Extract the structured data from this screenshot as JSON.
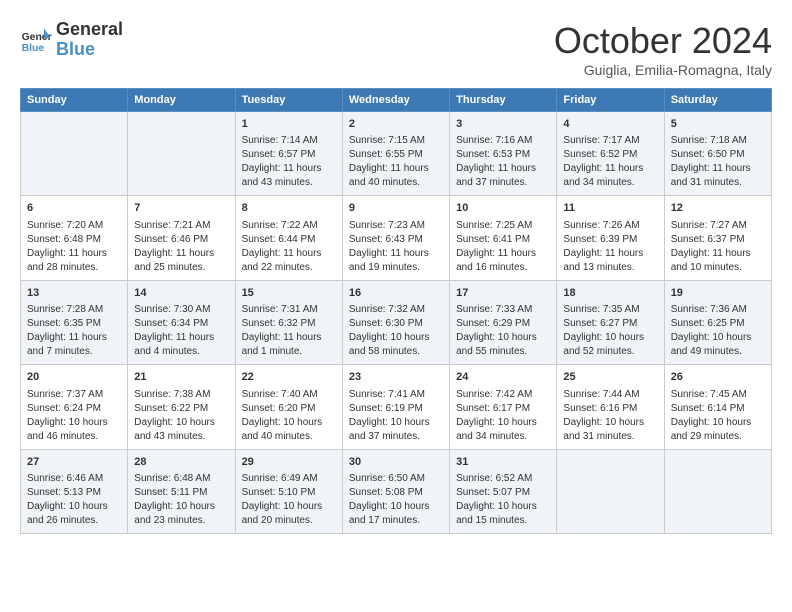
{
  "header": {
    "logo_line1": "General",
    "logo_line2": "Blue",
    "month": "October 2024",
    "location": "Guiglia, Emilia-Romagna, Italy"
  },
  "weekdays": [
    "Sunday",
    "Monday",
    "Tuesday",
    "Wednesday",
    "Thursday",
    "Friday",
    "Saturday"
  ],
  "weeks": [
    [
      {
        "day": "",
        "info": ""
      },
      {
        "day": "",
        "info": ""
      },
      {
        "day": "1",
        "info": "Sunrise: 7:14 AM\nSunset: 6:57 PM\nDaylight: 11 hours\nand 43 minutes."
      },
      {
        "day": "2",
        "info": "Sunrise: 7:15 AM\nSunset: 6:55 PM\nDaylight: 11 hours\nand 40 minutes."
      },
      {
        "day": "3",
        "info": "Sunrise: 7:16 AM\nSunset: 6:53 PM\nDaylight: 11 hours\nand 37 minutes."
      },
      {
        "day": "4",
        "info": "Sunrise: 7:17 AM\nSunset: 6:52 PM\nDaylight: 11 hours\nand 34 minutes."
      },
      {
        "day": "5",
        "info": "Sunrise: 7:18 AM\nSunset: 6:50 PM\nDaylight: 11 hours\nand 31 minutes."
      }
    ],
    [
      {
        "day": "6",
        "info": "Sunrise: 7:20 AM\nSunset: 6:48 PM\nDaylight: 11 hours\nand 28 minutes."
      },
      {
        "day": "7",
        "info": "Sunrise: 7:21 AM\nSunset: 6:46 PM\nDaylight: 11 hours\nand 25 minutes."
      },
      {
        "day": "8",
        "info": "Sunrise: 7:22 AM\nSunset: 6:44 PM\nDaylight: 11 hours\nand 22 minutes."
      },
      {
        "day": "9",
        "info": "Sunrise: 7:23 AM\nSunset: 6:43 PM\nDaylight: 11 hours\nand 19 minutes."
      },
      {
        "day": "10",
        "info": "Sunrise: 7:25 AM\nSunset: 6:41 PM\nDaylight: 11 hours\nand 16 minutes."
      },
      {
        "day": "11",
        "info": "Sunrise: 7:26 AM\nSunset: 6:39 PM\nDaylight: 11 hours\nand 13 minutes."
      },
      {
        "day": "12",
        "info": "Sunrise: 7:27 AM\nSunset: 6:37 PM\nDaylight: 11 hours\nand 10 minutes."
      }
    ],
    [
      {
        "day": "13",
        "info": "Sunrise: 7:28 AM\nSunset: 6:35 PM\nDaylight: 11 hours\nand 7 minutes."
      },
      {
        "day": "14",
        "info": "Sunrise: 7:30 AM\nSunset: 6:34 PM\nDaylight: 11 hours\nand 4 minutes."
      },
      {
        "day": "15",
        "info": "Sunrise: 7:31 AM\nSunset: 6:32 PM\nDaylight: 11 hours\nand 1 minute."
      },
      {
        "day": "16",
        "info": "Sunrise: 7:32 AM\nSunset: 6:30 PM\nDaylight: 10 hours\nand 58 minutes."
      },
      {
        "day": "17",
        "info": "Sunrise: 7:33 AM\nSunset: 6:29 PM\nDaylight: 10 hours\nand 55 minutes."
      },
      {
        "day": "18",
        "info": "Sunrise: 7:35 AM\nSunset: 6:27 PM\nDaylight: 10 hours\nand 52 minutes."
      },
      {
        "day": "19",
        "info": "Sunrise: 7:36 AM\nSunset: 6:25 PM\nDaylight: 10 hours\nand 49 minutes."
      }
    ],
    [
      {
        "day": "20",
        "info": "Sunrise: 7:37 AM\nSunset: 6:24 PM\nDaylight: 10 hours\nand 46 minutes."
      },
      {
        "day": "21",
        "info": "Sunrise: 7:38 AM\nSunset: 6:22 PM\nDaylight: 10 hours\nand 43 minutes."
      },
      {
        "day": "22",
        "info": "Sunrise: 7:40 AM\nSunset: 6:20 PM\nDaylight: 10 hours\nand 40 minutes."
      },
      {
        "day": "23",
        "info": "Sunrise: 7:41 AM\nSunset: 6:19 PM\nDaylight: 10 hours\nand 37 minutes."
      },
      {
        "day": "24",
        "info": "Sunrise: 7:42 AM\nSunset: 6:17 PM\nDaylight: 10 hours\nand 34 minutes."
      },
      {
        "day": "25",
        "info": "Sunrise: 7:44 AM\nSunset: 6:16 PM\nDaylight: 10 hours\nand 31 minutes."
      },
      {
        "day": "26",
        "info": "Sunrise: 7:45 AM\nSunset: 6:14 PM\nDaylight: 10 hours\nand 29 minutes."
      }
    ],
    [
      {
        "day": "27",
        "info": "Sunrise: 6:46 AM\nSunset: 5:13 PM\nDaylight: 10 hours\nand 26 minutes."
      },
      {
        "day": "28",
        "info": "Sunrise: 6:48 AM\nSunset: 5:11 PM\nDaylight: 10 hours\nand 23 minutes."
      },
      {
        "day": "29",
        "info": "Sunrise: 6:49 AM\nSunset: 5:10 PM\nDaylight: 10 hours\nand 20 minutes."
      },
      {
        "day": "30",
        "info": "Sunrise: 6:50 AM\nSunset: 5:08 PM\nDaylight: 10 hours\nand 17 minutes."
      },
      {
        "day": "31",
        "info": "Sunrise: 6:52 AM\nSunset: 5:07 PM\nDaylight: 10 hours\nand 15 minutes."
      },
      {
        "day": "",
        "info": ""
      },
      {
        "day": "",
        "info": ""
      }
    ]
  ]
}
